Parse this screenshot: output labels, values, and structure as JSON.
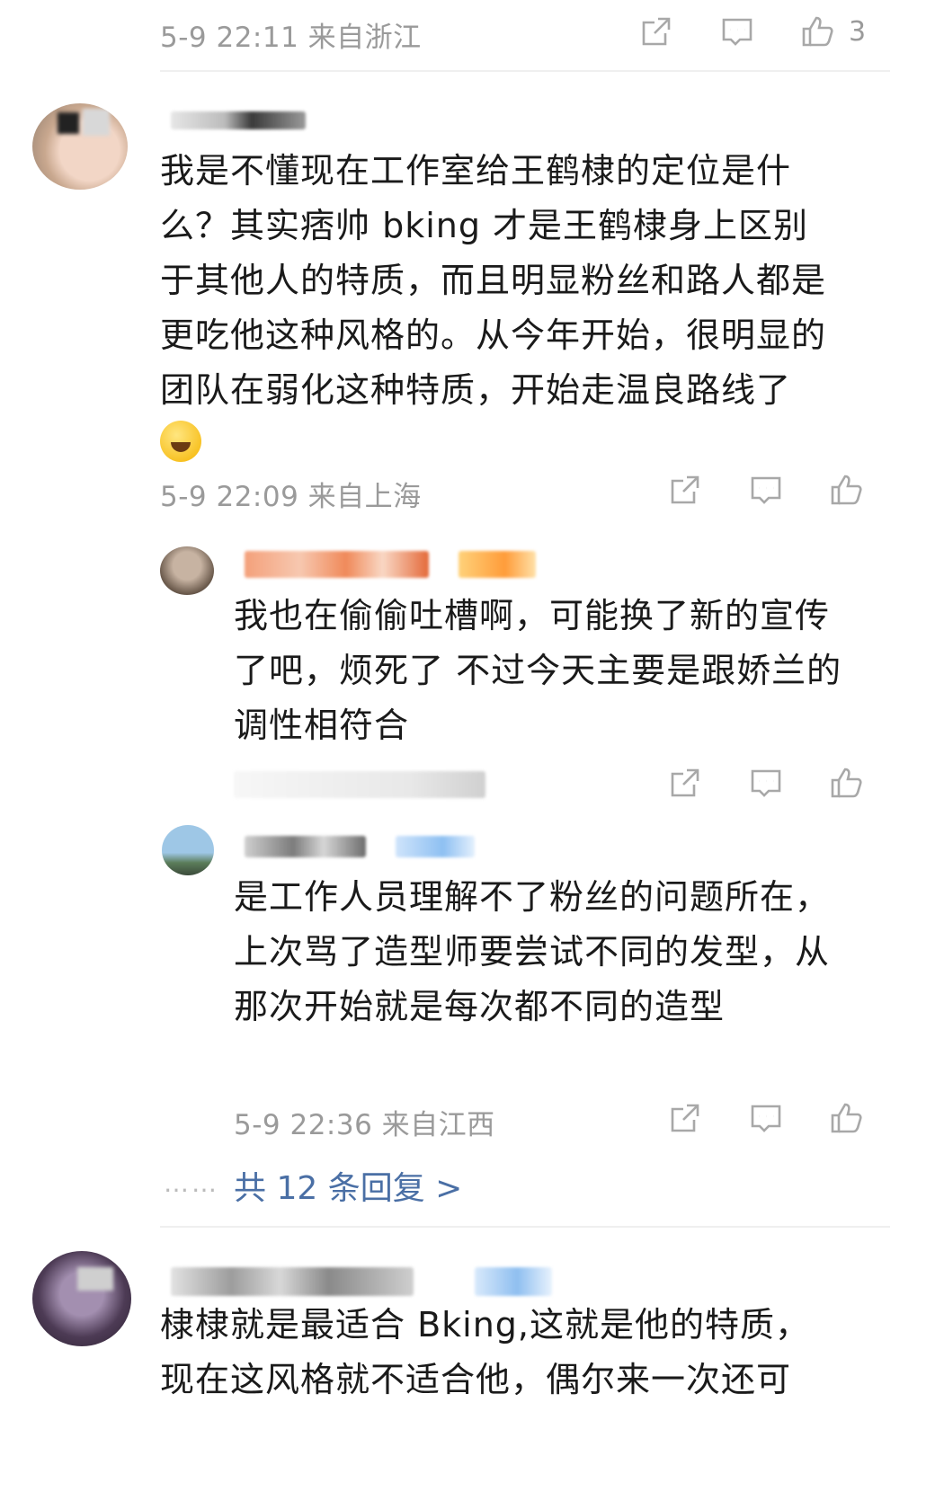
{
  "top_meta": {
    "time_location": "5-9 22:11 来自浙江",
    "like_count": "3"
  },
  "comment1": {
    "text": "我是不懂现在工作室给王鹤棣的定位是什么？其实痞帅 bking 才是王鹤棣身上区别于其他人的特质，而且明显粉丝和路人都是更吃他这种风格的。从今年开始，很明显的团队在弱化这种特质，开始走温良路线了",
    "emoji": "laughing-crying-emoji",
    "meta": "5-9 22:09 来自上海"
  },
  "reply1": {
    "text": "我也在偷偷吐槽啊，可能换了新的宣传了吧，烦死了 不过今天主要是跟娇兰的调性相符合"
  },
  "reply2": {
    "text": "是工作人员理解不了粉丝的问题所在，上次骂了造型师要尝试不同的发型，从那次开始就是每次都不同的造型",
    "meta": "5-9 22:36 来自江西"
  },
  "more_replies": {
    "dots": "……",
    "label": "共 12 条回复 >"
  },
  "comment2": {
    "text_line1": "棣棣就是最适合 Bking,这就是他的特质，",
    "text_line2": "现在这风格就不适合他，偶尔来一次还可"
  },
  "colors": {
    "meta_gray": "#9a9a9a",
    "link_blue": "#4a6fa5",
    "icon_gray": "#a8a8a8"
  }
}
